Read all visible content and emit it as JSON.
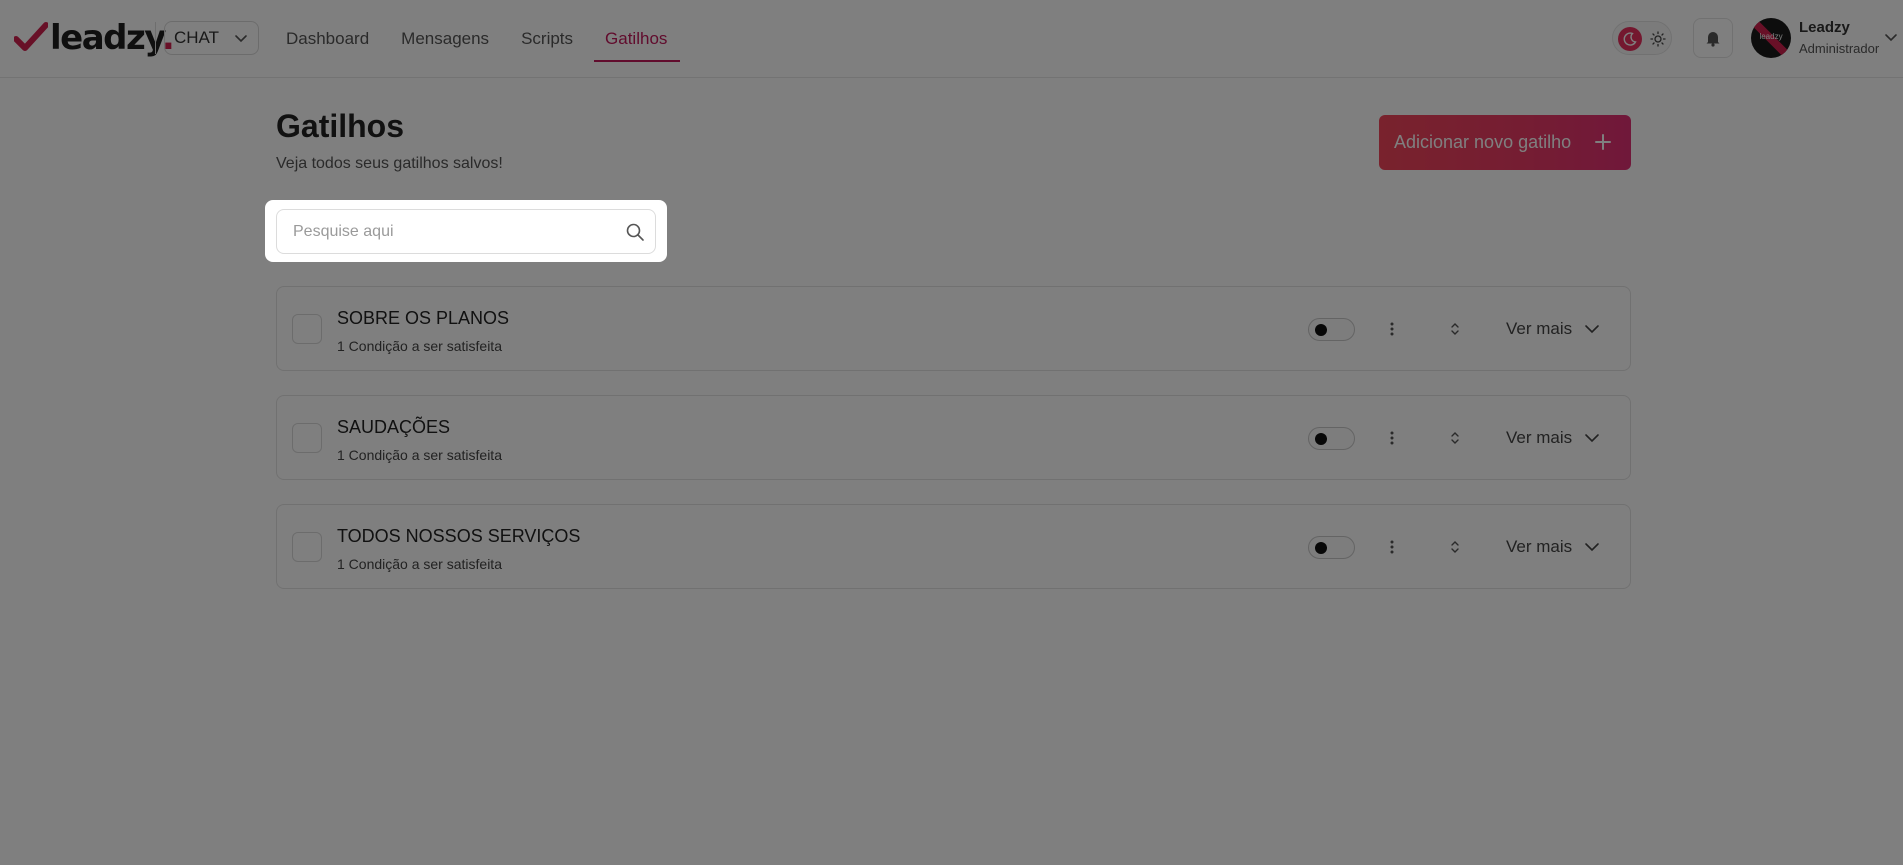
{
  "header": {
    "logo_text": "leadzy",
    "logo_dot": ".",
    "product_select": "CHAT",
    "nav": [
      {
        "label": "Dashboard",
        "active": false
      },
      {
        "label": "Mensagens",
        "active": false
      },
      {
        "label": "Scripts",
        "active": false
      },
      {
        "label": "Gatilhos",
        "active": true
      }
    ],
    "user": {
      "name": "Leadzy",
      "role": "Administrador",
      "avatar_text": "leadzy"
    },
    "theme": {
      "dark_icon": "moon-icon",
      "light_icon": "sun-icon",
      "selected": "dark"
    }
  },
  "page": {
    "title": "Gatilhos",
    "subtitle": "Veja todos seus gatilhos salvos!",
    "add_button": "Adicionar novo gatilho"
  },
  "search": {
    "placeholder": "Pesquise aqui",
    "value": ""
  },
  "triggers": [
    {
      "title": "SOBRE OS PLANOS",
      "conditions": "1 Condição a ser satisfeita",
      "enabled": false,
      "more_label": "Ver mais"
    },
    {
      "title": "SAUDAÇÕES",
      "conditions": "1 Condição a ser satisfeita",
      "enabled": false,
      "more_label": "Ver mais"
    },
    {
      "title": "TODOS NOSSOS SERVIÇOS",
      "conditions": "1 Condição a ser satisfeita",
      "enabled": false,
      "more_label": "Ver mais"
    }
  ],
  "colors": {
    "accent": "#c2185b",
    "button_gradient_start": "#f2455a",
    "button_gradient_end": "#e13075",
    "overlay": "rgba(0,0,0,0.5)"
  }
}
